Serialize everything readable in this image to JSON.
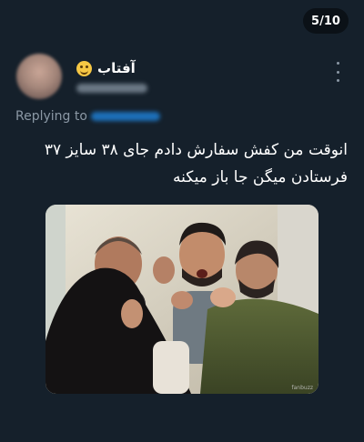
{
  "viewer": {
    "counter": "5/10"
  },
  "tweet": {
    "author": {
      "display_name": "آفتاب",
      "emoji": "smiling-face-emoji"
    },
    "replying_prefix": "Replying to",
    "text_lines": [
      "انوقت من کفش سفارش دادم جای ۳۸ سایز ۳۷",
      "فرستادن میگن جا باز میکنه"
    ],
    "media": {
      "watermark": "fanbuzz"
    }
  },
  "colors": {
    "background": "#15202b",
    "text_primary": "#ffffff",
    "text_secondary": "#8b98a5",
    "link": "#1d9bf0"
  },
  "icons": [
    "more-vertical-icon",
    "smiling-face-emoji"
  ]
}
